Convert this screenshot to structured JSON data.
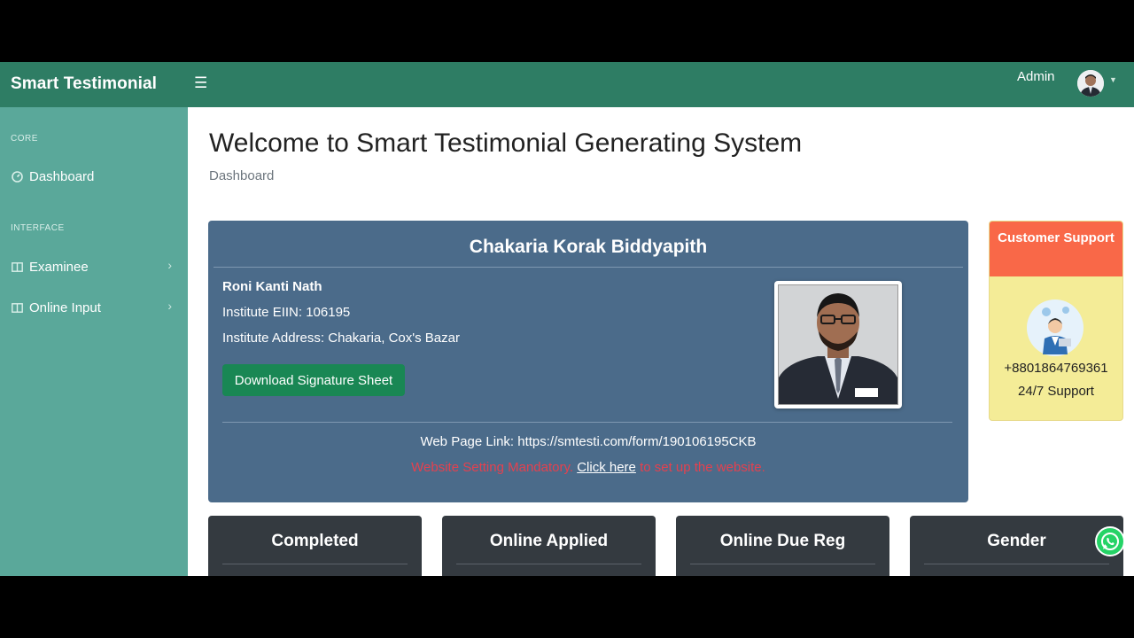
{
  "topnav": {
    "brand": "Smart Testimonial",
    "toggle_icon": "menu-icon",
    "admin_label": "Admin"
  },
  "sidebar": {
    "headings": {
      "core": "CORE",
      "interface": "INTERFACE"
    },
    "items": [
      {
        "label": "Dashboard",
        "icon": "dashboard-icon"
      },
      {
        "label": "Examinee",
        "icon": "columns-icon"
      },
      {
        "label": "Online Input",
        "icon": "columns-icon"
      }
    ]
  },
  "main": {
    "title": "Welcome to Smart Testimonial Generating System",
    "breadcrumb": "Dashboard"
  },
  "institute": {
    "name": "Chakaria Korak Biddyapith",
    "person": "Roni Kanti Nath",
    "eiin": "Institute EIIN: 106195",
    "address": "Institute Address: Chakaria, Cox's Bazar",
    "download_label": "Download Signature Sheet",
    "weblink": "Web Page Link: https://smtesti.com/form/190106195CKB",
    "warning_prefix": "Website Setting Mandatory.",
    "warning_link": "Click here",
    "warning_suffix": "to set up the website."
  },
  "support": {
    "title": "Customer Support",
    "phone": "+8801864769361",
    "hours": "24/7 Support"
  },
  "stats": [
    {
      "title": "Completed"
    },
    {
      "title": "Online Applied"
    },
    {
      "title": "Online Due Reg"
    },
    {
      "title": "Gender"
    }
  ],
  "colors": {
    "topnav": "#2e7d64",
    "sidebar": "#5aa89a",
    "institute_card": "#4b6b8a",
    "download_button": "#198754",
    "support_header": "#f96848",
    "support_body": "#f4ec97",
    "stat_card": "#343a40",
    "warning_text": "#e4414f",
    "whatsapp": "#25d366"
  }
}
